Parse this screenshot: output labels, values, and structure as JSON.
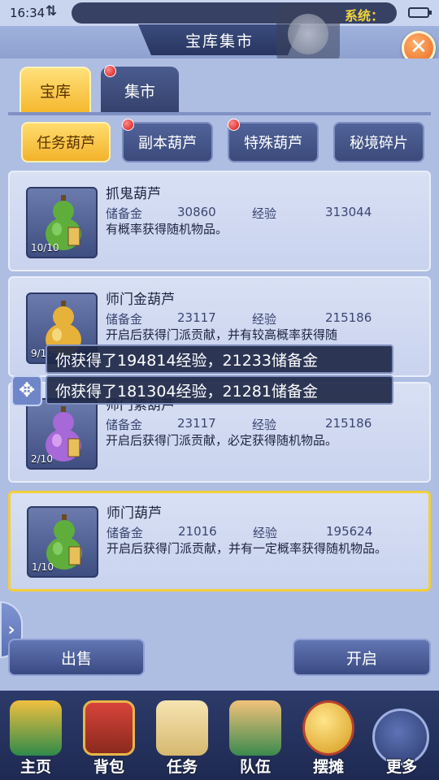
{
  "status": {
    "time": "16:34",
    "arrows": "⇅",
    "system_label": "系统："
  },
  "header": {
    "title": "宝库集市",
    "close_symbol": "✕"
  },
  "tabs": [
    {
      "label": "宝库",
      "active": true,
      "red_dot": false
    },
    {
      "label": "集市",
      "active": false,
      "red_dot": true
    }
  ],
  "subtabs": [
    {
      "label": "任务葫芦",
      "active": true,
      "red_dot": false
    },
    {
      "label": "副本葫芦",
      "active": false,
      "red_dot": true
    },
    {
      "label": "特殊葫芦",
      "active": false,
      "red_dot": true
    },
    {
      "label": "秘境碎片",
      "active": false,
      "red_dot": false
    }
  ],
  "items": [
    {
      "name": "抓鬼葫芦",
      "stat1_label": "储备金",
      "stat1_value": "30860",
      "stat2_label": "经验",
      "stat2_value": "313044",
      "desc": "有概率获得随机物品。",
      "count": "10/10",
      "gourd_color": "#5fae3c",
      "icon": "gourd-ghost-icon"
    },
    {
      "name": "师门金葫芦",
      "stat1_label": "储备金",
      "stat1_value": "23117",
      "stat2_label": "经验",
      "stat2_value": "215186",
      "desc": "开启后获得门派贡献，并有较高概率获得随",
      "count": "9/10",
      "gourd_color": "#e6b23a",
      "icon": "gourd-gold-icon"
    },
    {
      "name": "师门紫葫芦",
      "stat1_label": "储备金",
      "stat1_value": "23117",
      "stat2_label": "经验",
      "stat2_value": "215186",
      "desc": "开启后获得门派贡献，必定获得随机物品。",
      "count": "2/10",
      "gourd_color": "#a768d8",
      "icon": "gourd-purple-icon"
    },
    {
      "name": "师门葫芦",
      "stat1_label": "储备金",
      "stat1_value": "21016",
      "stat2_label": "经验",
      "stat2_value": "195624",
      "desc": "开启后获得门派贡献，并有一定概率获得随机物品。",
      "count": "1/10",
      "gourd_color": "#5fae3c",
      "icon": "gourd-green-icon"
    }
  ],
  "toasts": [
    "你获得了194814经验，21233储备金",
    "你获得了181304经验，21281储备金"
  ],
  "buttons": {
    "sell": "出售",
    "open": "开启"
  },
  "nav": [
    {
      "label": "主页",
      "icon": "house-icon"
    },
    {
      "label": "背包",
      "icon": "chest-icon"
    },
    {
      "label": "任务",
      "icon": "scroll-icon"
    },
    {
      "label": "队伍",
      "icon": "team-icon"
    },
    {
      "label": "摆摊",
      "icon": "coin-stall-icon"
    },
    {
      "label": "更多",
      "icon": "more-icon"
    }
  ]
}
